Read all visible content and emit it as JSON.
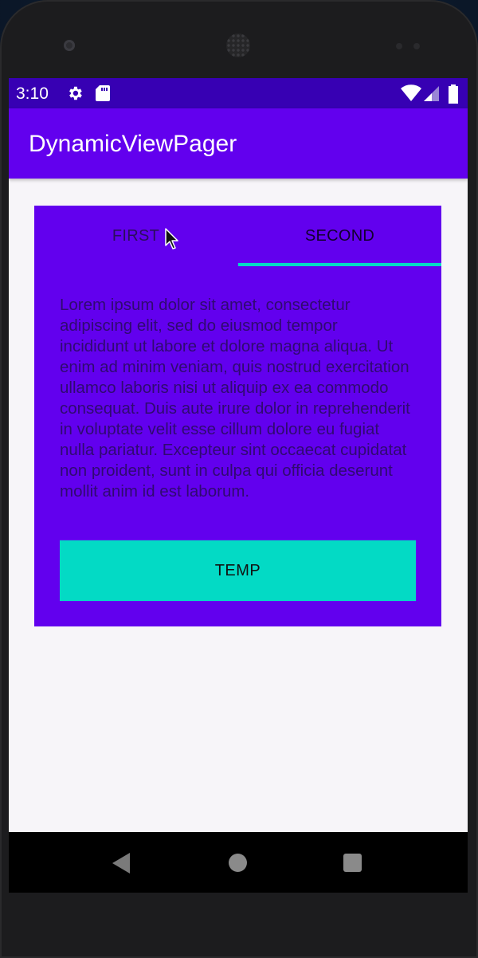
{
  "status_bar": {
    "time": "3:10",
    "icons": [
      "settings-icon",
      "sd-card-icon",
      "wifi-icon",
      "signal-icon",
      "battery-icon"
    ]
  },
  "app_bar": {
    "title": "DynamicViewPager"
  },
  "tabs": [
    {
      "label": "FIRST",
      "selected": false
    },
    {
      "label": "SECOND",
      "selected": true
    }
  ],
  "content": {
    "text": "Lorem ipsum dolor sit amet, consectetur adipiscing elit, sed do eiusmod tempor incididunt ut labore et dolore magna aliqua. Ut enim ad minim veniam, quis nostrud exercitation ullamco laboris nisi ut aliquip ex ea commodo consequat. Duis aute irure dolor in reprehenderit in voluptate velit esse cillum dolore eu fugiat nulla pariatur. Excepteur sint occaecat cupidatat non proident, sunt in culpa qui officia deserunt mollit anim id est laborum.",
    "button_label": "TEMP"
  },
  "nav_bar": {
    "icons": [
      "back-icon",
      "home-icon",
      "recents-icon"
    ]
  },
  "colors": {
    "status_bar": "#3700b3",
    "primary": "#6200ee",
    "accent": "#03dac5",
    "background": "#f7f5f9"
  }
}
